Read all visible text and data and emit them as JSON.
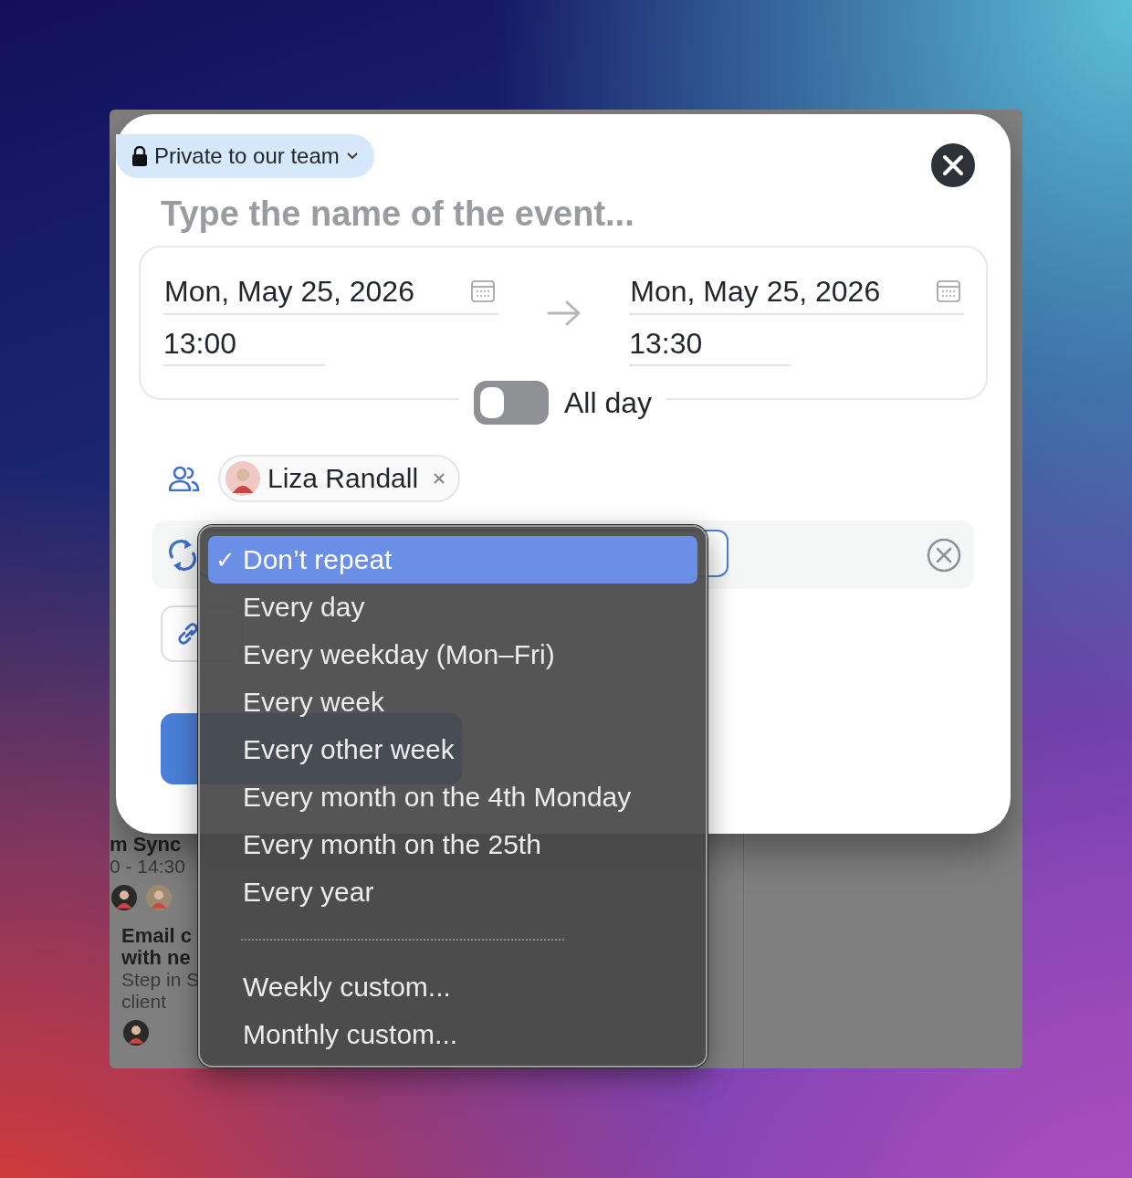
{
  "privacy": {
    "label": "Private to our team"
  },
  "event_name": {
    "placeholder": "Type the name of the event..."
  },
  "start": {
    "date": "Mon, May 25, 2026",
    "time": "13:00"
  },
  "end": {
    "date": "Mon, May 25, 2026",
    "time": "13:30"
  },
  "all_day": {
    "label": "All day",
    "on": false
  },
  "attendees": [
    {
      "name": "Liza Randall"
    }
  ],
  "repeat_menu": {
    "check_mark": "✓",
    "items": [
      {
        "kind": "option",
        "label": "Don’t repeat",
        "selected": true
      },
      {
        "kind": "option",
        "label": "Every day",
        "selected": false
      },
      {
        "kind": "option",
        "label": "Every weekday (Mon–Fri)",
        "selected": false
      },
      {
        "kind": "option",
        "label": "Every week",
        "selected": false
      },
      {
        "kind": "option",
        "label": "Every other week",
        "selected": false
      },
      {
        "kind": "option",
        "label": "Every month on the 4th Monday",
        "selected": false
      },
      {
        "kind": "option",
        "label": "Every month on the 25th",
        "selected": false
      },
      {
        "kind": "option",
        "label": "Every year",
        "selected": false
      },
      {
        "kind": "separator"
      },
      {
        "kind": "option",
        "label": "Weekly custom...",
        "selected": false
      },
      {
        "kind": "option",
        "label": "Monthly custom...",
        "selected": false
      }
    ]
  },
  "background_events": [
    {
      "title_lines": [
        "m Sync"
      ],
      "time": "0 - 14:30",
      "avatars": [
        {
          "kind": "person"
        },
        {
          "kind": "person"
        }
      ]
    },
    {
      "title_lines": [
        "Email c",
        "with ne"
      ],
      "note_lines": [
        "Step in S",
        "client"
      ],
      "avatars": [
        {
          "kind": "person"
        }
      ]
    }
  ]
}
